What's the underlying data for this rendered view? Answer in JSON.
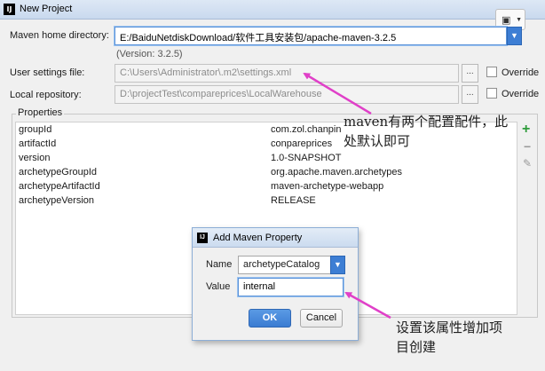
{
  "window": {
    "title": "New Project",
    "app_icon_text": "IJ"
  },
  "maven_home": {
    "label": "Maven home directory:",
    "value": "E:/BaiduNetdiskDownload/软件工具安装包/apache-maven-3.2.5",
    "version": "(Version: 3.2.5)"
  },
  "user_settings": {
    "label": "User settings file:",
    "value": "C:\\Users\\Administrator\\.m2\\settings.xml",
    "browse_label": "...",
    "override_label": "Override"
  },
  "local_repo": {
    "label": "Local repository:",
    "value": "D:\\projectTest\\compareprices\\LocalWarehouse",
    "browse_label": "...",
    "override_label": "Override"
  },
  "properties": {
    "title": "Properties",
    "rows": [
      {
        "key": "groupId",
        "value": "com.zol.chanpin"
      },
      {
        "key": "artifactId",
        "value": "conpareprices"
      },
      {
        "key": "version",
        "value": "1.0-SNAPSHOT"
      },
      {
        "key": "archetypeGroupId",
        "value": "org.apache.maven.archetypes"
      },
      {
        "key": "archetypeArtifactId",
        "value": "maven-archetype-webapp"
      },
      {
        "key": "archetypeVersion",
        "value": "RELEASE"
      }
    ],
    "tools": {
      "add": "+",
      "remove": "−",
      "edit": "✎"
    }
  },
  "dialog": {
    "title": "Add Maven Property",
    "name_label": "Name",
    "name_value": "archetypeCatalog",
    "value_label": "Value",
    "value_value": "internal",
    "ok_label": "OK",
    "cancel_label": "Cancel"
  },
  "annotations": {
    "note1_line1": "maven有两个配置配件，此",
    "note1_line2": "处默认即可",
    "note2_line1": "设置该属性增加项",
    "note2_line2": "目创建",
    "arrow_color": "#e040c8"
  },
  "icons": {
    "app": "intellij-icon",
    "screenshot": "picture-icon",
    "dropdown": "chevron-down-icon"
  }
}
